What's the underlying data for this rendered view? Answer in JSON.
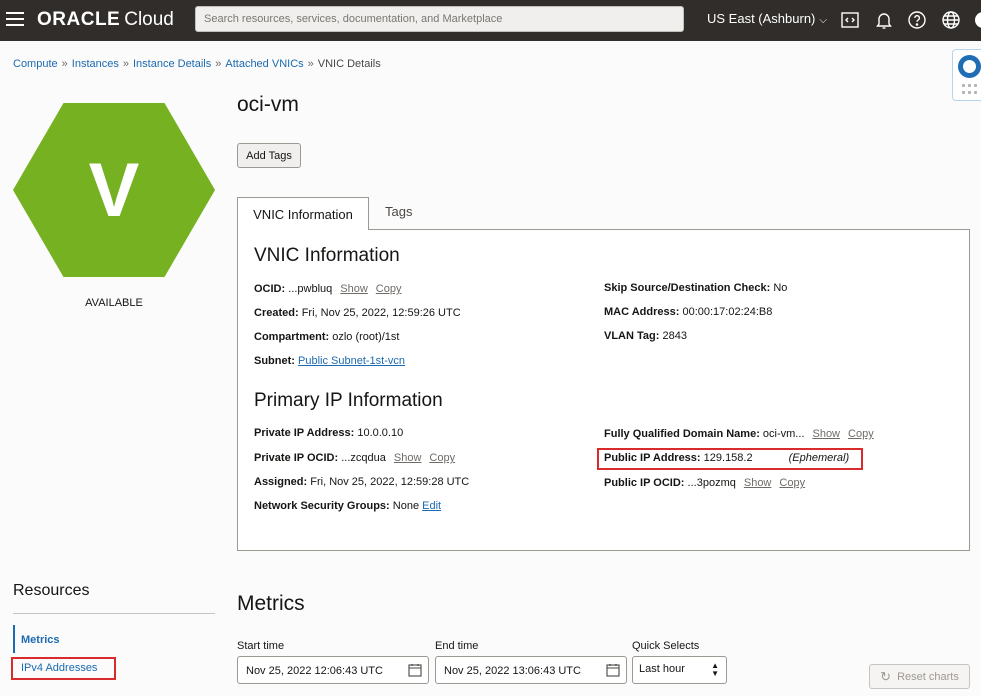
{
  "topbar": {
    "brand": "ORACLE",
    "brand_product": "Cloud",
    "search_placeholder": "Search resources, services, documentation, and Marketplace",
    "region": "US East (Ashburn)"
  },
  "breadcrumb": [
    {
      "label": "Compute"
    },
    {
      "label": "Instances"
    },
    {
      "label": "Instance Details"
    },
    {
      "label": "Attached VNICs"
    },
    {
      "label": "VNIC Details"
    }
  ],
  "breadcrumb_sep": "»",
  "resource": {
    "icon_letter": "V",
    "icon_color": "#76b121",
    "status": "AVAILABLE",
    "name": "oci-vm"
  },
  "buttons": {
    "add_tags": "Add Tags",
    "reset_charts": "Reset charts"
  },
  "tabs": {
    "vnic_info": "VNIC Information",
    "tags": "Tags"
  },
  "vnic_info": {
    "heading": "VNIC Information",
    "ocid_label": "OCID:",
    "ocid_value": "...pwbluq",
    "show": "Show",
    "copy": "Copy",
    "created_label": "Created:",
    "created_value": "Fri, Nov 25, 2022, 12:59:26 UTC",
    "compartment_label": "Compartment:",
    "compartment_value": "ozlo (root)/1st",
    "subnet_label": "Subnet:",
    "subnet_value": "Public Subnet-1st-vcn",
    "skip_label": "Skip Source/Destination Check:",
    "skip_value": "No",
    "mac_label": "MAC Address:",
    "mac_value": "00:00:17:02:24:B8",
    "vlan_label": "VLAN Tag:",
    "vlan_value": "2843"
  },
  "primary_ip": {
    "heading": "Primary IP Information",
    "private_ip_label": "Private IP Address:",
    "private_ip_value": "10.0.0.10",
    "private_ocid_label": "Private IP OCID:",
    "private_ocid_value": "...zcqdua",
    "assigned_label": "Assigned:",
    "assigned_value": "Fri, Nov 25, 2022, 12:59:28 UTC",
    "nsg_label": "Network Security Groups:",
    "nsg_value": "None",
    "nsg_edit": "Edit",
    "fqdn_label": "Fully Qualified Domain Name:",
    "fqdn_value": "oci-vm...",
    "public_ip_label": "Public IP Address:",
    "public_ip_value": "129.158.2",
    "public_ip_type": "(Ephemeral)",
    "public_ocid_label": "Public IP OCID:",
    "public_ocid_value": "...3pozmq"
  },
  "resources": {
    "heading": "Resources",
    "items": [
      "Metrics",
      "IPv4 Addresses"
    ]
  },
  "metrics": {
    "heading": "Metrics",
    "start_label": "Start time",
    "start_value": "Nov 25, 2022 12:06:43 UTC",
    "end_label": "End time",
    "end_value": "Nov 25, 2022 13:06:43 UTC",
    "quick_label": "Quick Selects",
    "quick_value": "Last hour"
  }
}
